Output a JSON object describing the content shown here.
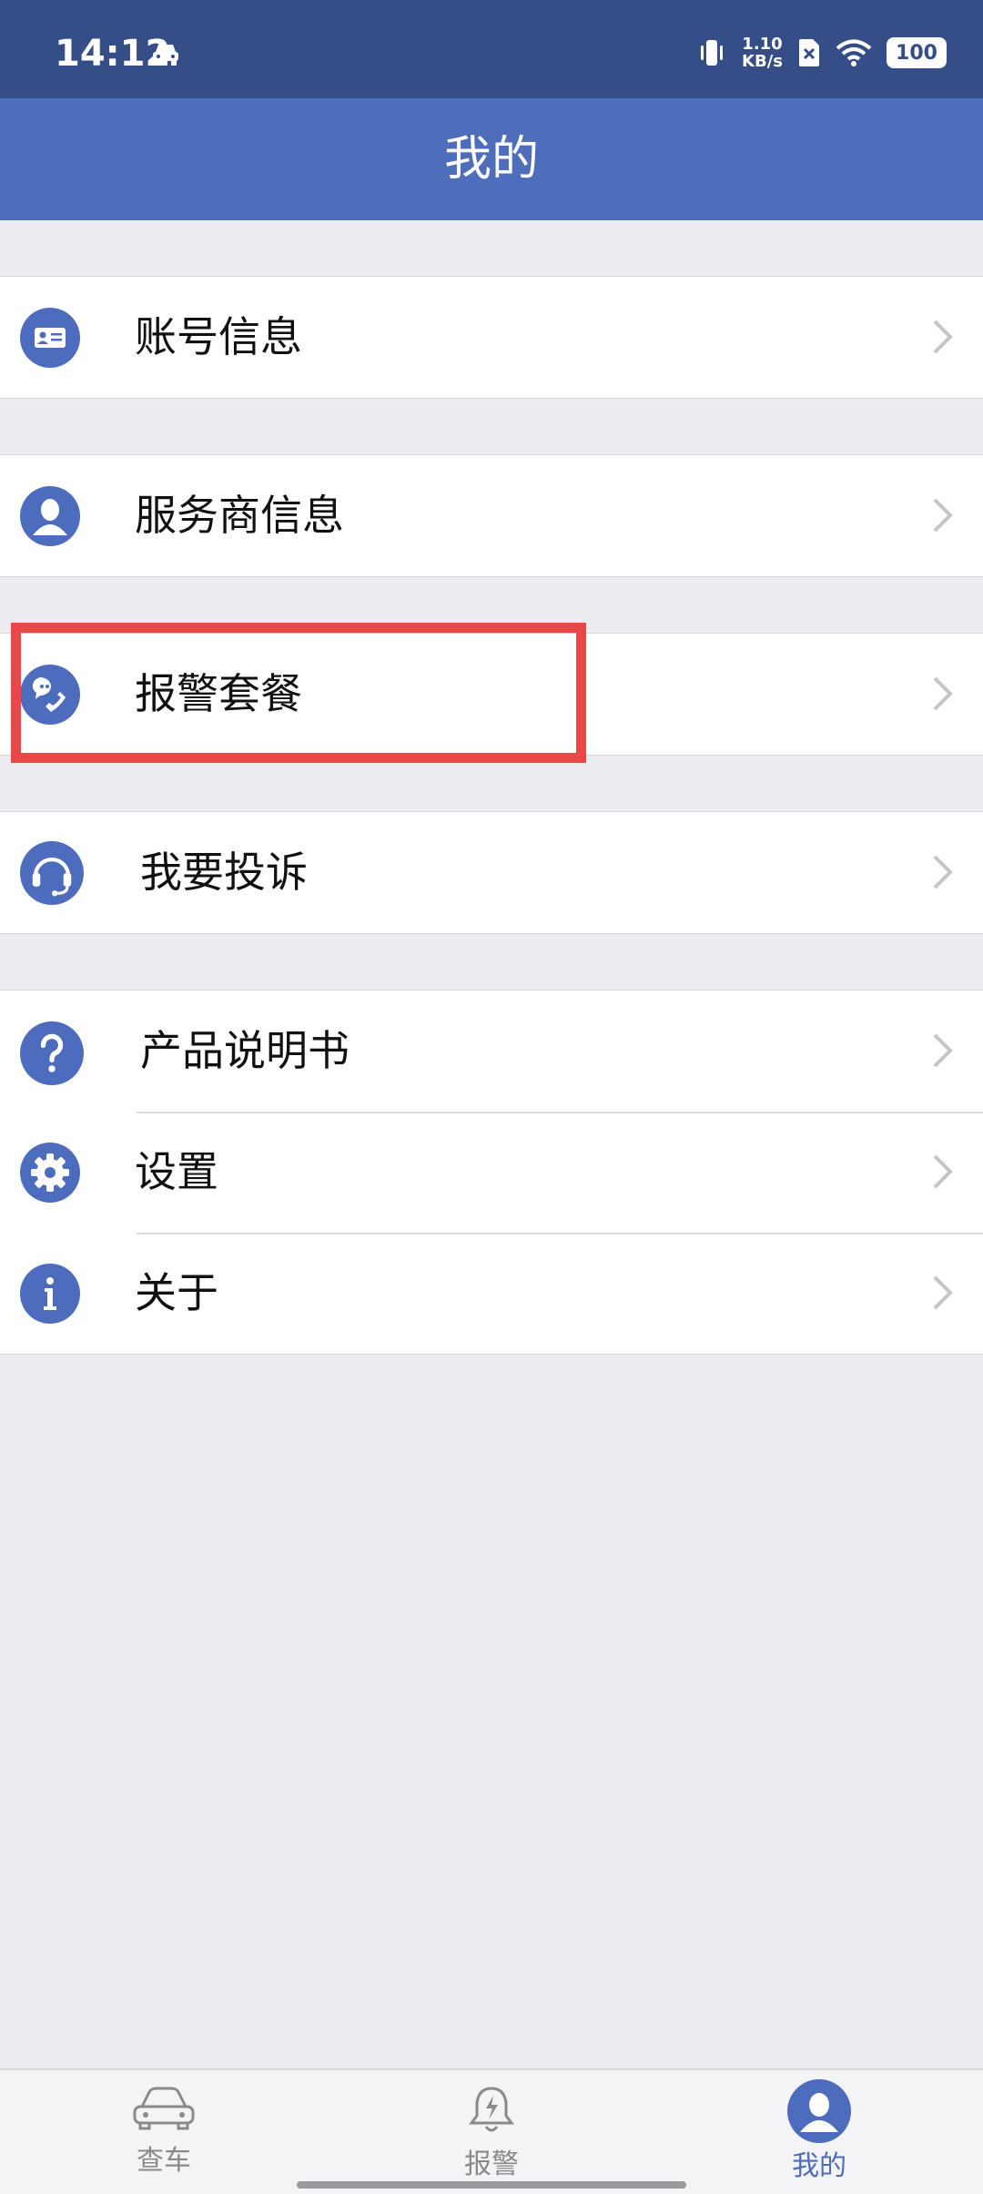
{
  "status_bar": {
    "time": "14:12",
    "net_speed_value": "1.10",
    "net_speed_unit": "KB/s",
    "battery": "100"
  },
  "header": {
    "title": "我的"
  },
  "menu": {
    "account": "账号信息",
    "provider": "服务商信息",
    "alarm_package": "报警套餐",
    "complaint": "我要投诉",
    "manual": "产品说明书",
    "settings": "设置",
    "about": "关于"
  },
  "tabs": {
    "car": "查车",
    "alarm": "报警",
    "mine": "我的"
  },
  "colors": {
    "status_bar": "#364e87",
    "title_bar": "#4e6dbb",
    "icon": "#4d6cbd",
    "highlight": "#e94848",
    "tab_active": "#4d6cbd",
    "tab_inactive": "#8a8a8e"
  }
}
